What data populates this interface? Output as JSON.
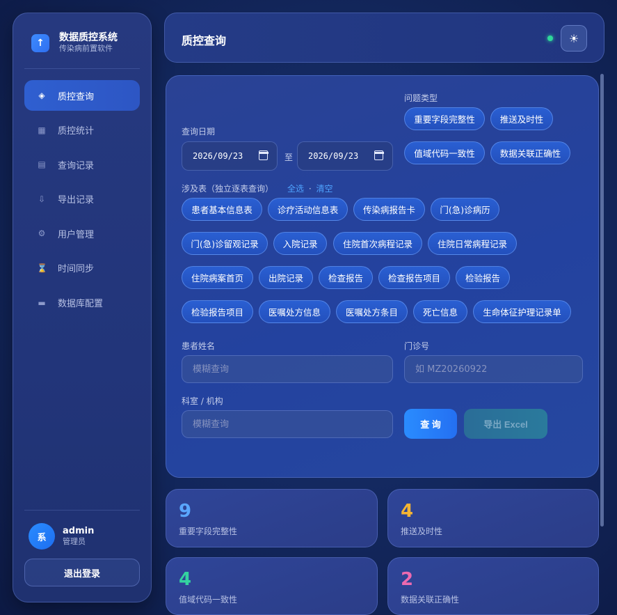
{
  "brand": {
    "title": "数据质控系统",
    "subtitle": "传染病前置软件",
    "icon": "arrow-up-icon"
  },
  "nav": [
    {
      "label": "质控查询",
      "icon": "diamond-icon",
      "active": true
    },
    {
      "label": "质控统计",
      "icon": "grid-icon",
      "active": false
    },
    {
      "label": "查询记录",
      "icon": "list-icon",
      "active": false
    },
    {
      "label": "导出记录",
      "icon": "download-icon",
      "active": false
    },
    {
      "label": "用户管理",
      "icon": "gear-icon",
      "active": false
    },
    {
      "label": "时间同步",
      "icon": "hourglass-icon",
      "active": false
    },
    {
      "label": "数据库配置",
      "icon": "database-icon",
      "active": false
    }
  ],
  "user": {
    "name": "admin",
    "role": "管理员",
    "avatar": "系"
  },
  "logout_label": "退出登录",
  "header": {
    "title": "质控查询",
    "theme_icon": "sun-icon",
    "status_color": "#2fd79a"
  },
  "query": {
    "date_label": "查询日期",
    "date_from": "2026/09/23",
    "date_to": "2026/09/23",
    "to_label": "至",
    "issue_label": "问题类型",
    "issue_types": [
      "重要字段完整性",
      "推送及时性",
      "值域代码一致性",
      "数据关联正确性"
    ],
    "tables_label": "涉及表（独立逐表查询）",
    "select_all": "全选",
    "link_sep": "·",
    "clear": "清空",
    "tables": [
      "患者基本信息表",
      "诊疗活动信息表",
      "传染病报告卡",
      "门(急)诊病历",
      "门(急)诊留观记录",
      "入院记录",
      "住院首次病程记录",
      "住院日常病程记录",
      "住院病案首页",
      "出院记录",
      "检查报告",
      "检查报告项目",
      "检验报告",
      "检验报告项目",
      "医嘱处方信息",
      "医嘱处方条目",
      "死亡信息",
      "生命体征护理记录单"
    ],
    "patient_label": "患者姓名",
    "patient_placeholder": "模糊查询",
    "visit_label": "门诊号",
    "visit_placeholder": "如 MZ20260922",
    "dept_label": "科室 / 机构",
    "dept_placeholder": "模糊查询",
    "query_btn": "查 询",
    "export_btn": "导出 Excel"
  },
  "stats": [
    {
      "value": "9",
      "label": "重要字段完整性",
      "color": "#5aa7ff"
    },
    {
      "value": "4",
      "label": "推送及时性",
      "color": "#f5b533"
    },
    {
      "value": "4",
      "label": "值域代码一致性",
      "color": "#34d3a0"
    },
    {
      "value": "2",
      "label": "数据关联正确性",
      "color": "#ec6ab0"
    }
  ]
}
